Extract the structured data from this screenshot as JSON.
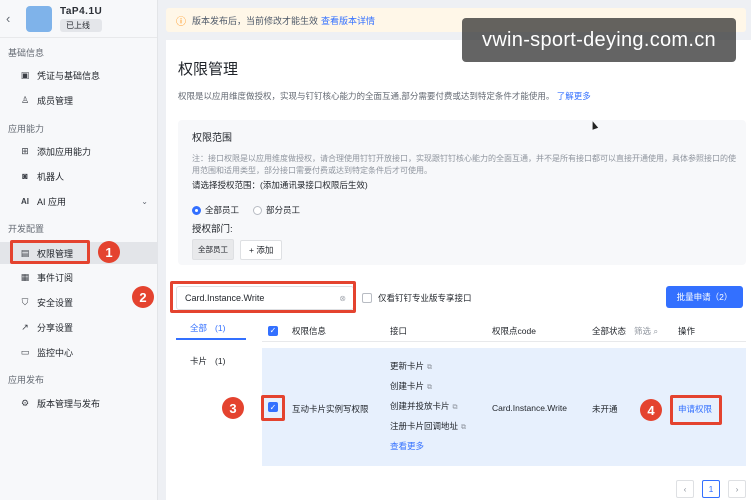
{
  "app": {
    "name": "TaP4.1U",
    "status": "已上线"
  },
  "sidebar": {
    "sections": [
      {
        "label": "基础信息"
      },
      {
        "label": "应用能力"
      },
      {
        "label": "开发配置"
      },
      {
        "label": "应用发布"
      }
    ],
    "items": [
      {
        "label": "凭证与基础信息",
        "icon": "certificate-icon"
      },
      {
        "label": "成员管理",
        "icon": "user-icon"
      },
      {
        "label": "添加应用能力",
        "icon": "grid-icon"
      },
      {
        "label": "机器人",
        "icon": "robot-icon"
      },
      {
        "label": "AI 应用",
        "icon": "ai-icon"
      },
      {
        "label": "权限管理",
        "icon": "permission-icon"
      },
      {
        "label": "事件订阅",
        "icon": "event-icon"
      },
      {
        "label": "安全设置",
        "icon": "shield-icon"
      },
      {
        "label": "分享设置",
        "icon": "share-icon"
      },
      {
        "label": "监控中心",
        "icon": "monitor-icon"
      },
      {
        "label": "版本管理与发布",
        "icon": "version-icon"
      }
    ]
  },
  "notice": {
    "text": "版本发布后，当前修改才能生效",
    "link": "查看版本详情"
  },
  "watermark": "vwin-sport-deying.com.cn",
  "page": {
    "title": "权限管理",
    "desc": "权限是以应用维度做授权，实现与钉钉核心能力的全面互通,部分需要付费或达到特定条件才能使用。",
    "desc_link": "了解更多"
  },
  "scope": {
    "title": "权限范围",
    "note": "注：接口权限是以应用维度做授权，请合理使用钉钉开放接口，实现跟钉钉核心能力的全面互通，并不是所有接口都可以直接开通使用，具体参照接口的使用范围和适用类型，部分接口需要付费或达到特定条件后才可使用。",
    "question": "请选择授权范围：(添加通讯录接口权限后生效)",
    "radio_all": "全部员工",
    "radio_part": "部分员工",
    "dept_label": "授权部门:",
    "dept_tag": "全部员工",
    "add_label": "+ 添加"
  },
  "toolbar": {
    "search_value": "Card.Instance.Write",
    "only_pro_label": "仅看钉钉专业版专享接口",
    "batch_label": "批量申请（2）"
  },
  "filters": [
    {
      "label": "全部",
      "count": "(1)"
    },
    {
      "label": "卡片",
      "count": "(1)"
    }
  ],
  "table": {
    "headers": {
      "info": "权限信息",
      "api": "接口",
      "code": "权限点code",
      "status": "全部状态",
      "filter": "筛选",
      "action": "操作"
    },
    "row": {
      "name": "互动卡片实例写权限",
      "apis": [
        "更新卡片",
        "创建卡片",
        "创建并投放卡片",
        "注册卡片回调地址"
      ],
      "more": "查看更多",
      "code": "Card.Instance.Write",
      "status": "未开通",
      "action": "申请权限"
    }
  },
  "pager": {
    "prev": "‹",
    "page": "1",
    "next": "›"
  },
  "annotations": [
    "1",
    "2",
    "3",
    "4"
  ],
  "colors": {
    "accent": "#3370ff",
    "annotation": "#e4432f"
  }
}
